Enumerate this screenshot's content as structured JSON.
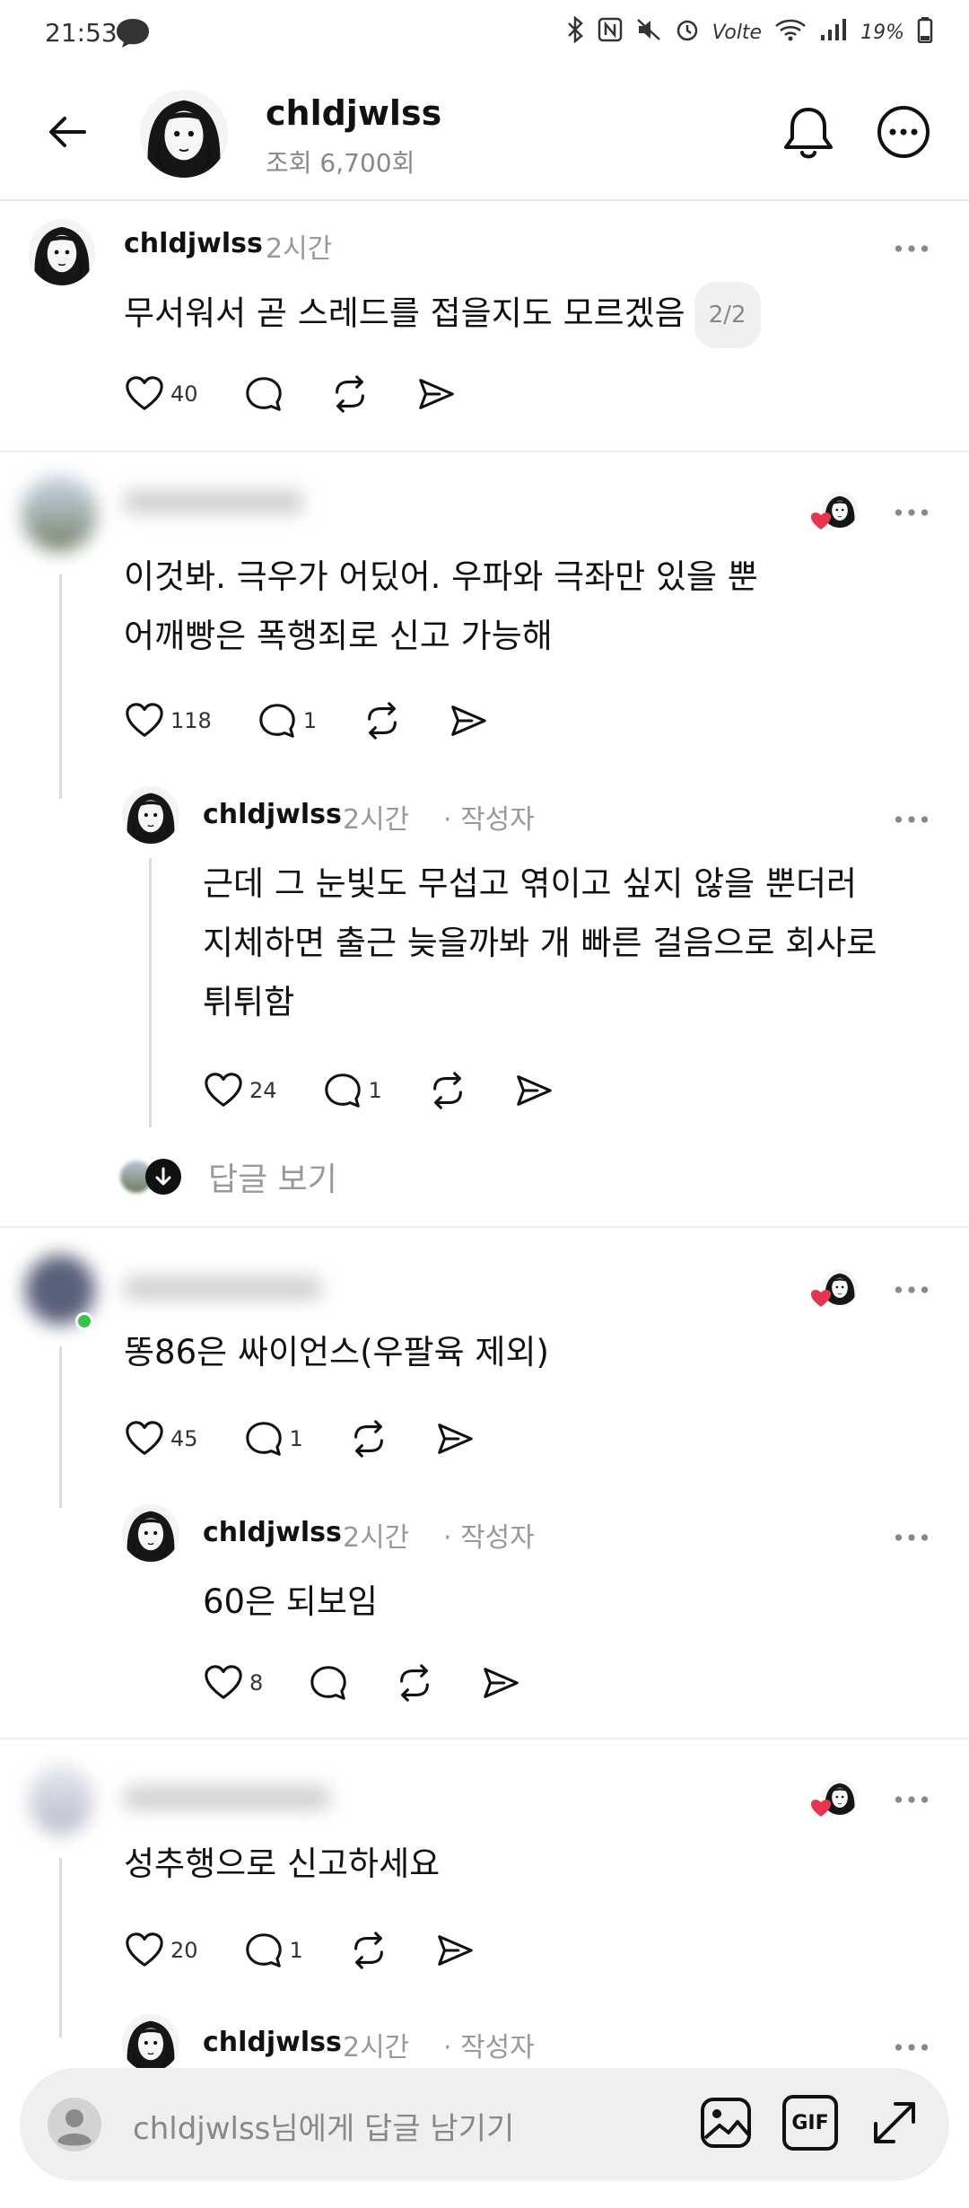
{
  "status_bar": {
    "time": "21:53",
    "network": "Volte",
    "battery": "19%"
  },
  "header": {
    "title": "chldjwlss",
    "views": "조회 6,700회"
  },
  "main_post": {
    "username": "chldjwlss",
    "time": "2시간",
    "text": "무서워서 곧 스레드를 접을지도 모르겠음",
    "page": "2/2",
    "likes": "40"
  },
  "replies": [
    {
      "username": "",
      "time": "",
      "text_lines": [
        "이것봐. 극우가 어딨어. 우파와 극좌만 있을 뿐",
        "어깨빵은 폭행죄로 신고 가능해"
      ],
      "likes": "118",
      "comments": "1",
      "author_reply": {
        "username": "chldjwlss",
        "time": "2시간",
        "badge": "· 작성자",
        "text_lines": [
          "근데 그 눈빛도 무섭고 엮이고 싶지 않을 뿐더러",
          "지체하면 출근 늦을까봐 개 빠른 걸음으로 회사로",
          "튀튀함"
        ],
        "likes": "24",
        "comments": "1"
      },
      "view_replies": "답글 보기"
    },
    {
      "username": "",
      "time": "",
      "text_lines": [
        "똥86은 싸이언스(우팔육 제외)"
      ],
      "likes": "45",
      "comments": "1",
      "author_reply": {
        "username": "chldjwlss",
        "time": "2시간",
        "badge": "· 작성자",
        "text_lines": [
          "60은 되보임"
        ],
        "likes": "8",
        "comments": ""
      }
    },
    {
      "username": "",
      "time": "",
      "text_lines": [
        "성추행으로 신고하세요"
      ],
      "likes": "20",
      "comments": "1",
      "author_reply": {
        "username": "chldjwlss",
        "time": "2시간",
        "badge": "· 작성자"
      }
    }
  ],
  "composer": {
    "placeholder": "chldjwlss님에게 답글 남기기",
    "gif_label": "GIF"
  },
  "colors": {
    "heart_red": "#e8344e",
    "text": "#111111",
    "muted": "#999999"
  }
}
